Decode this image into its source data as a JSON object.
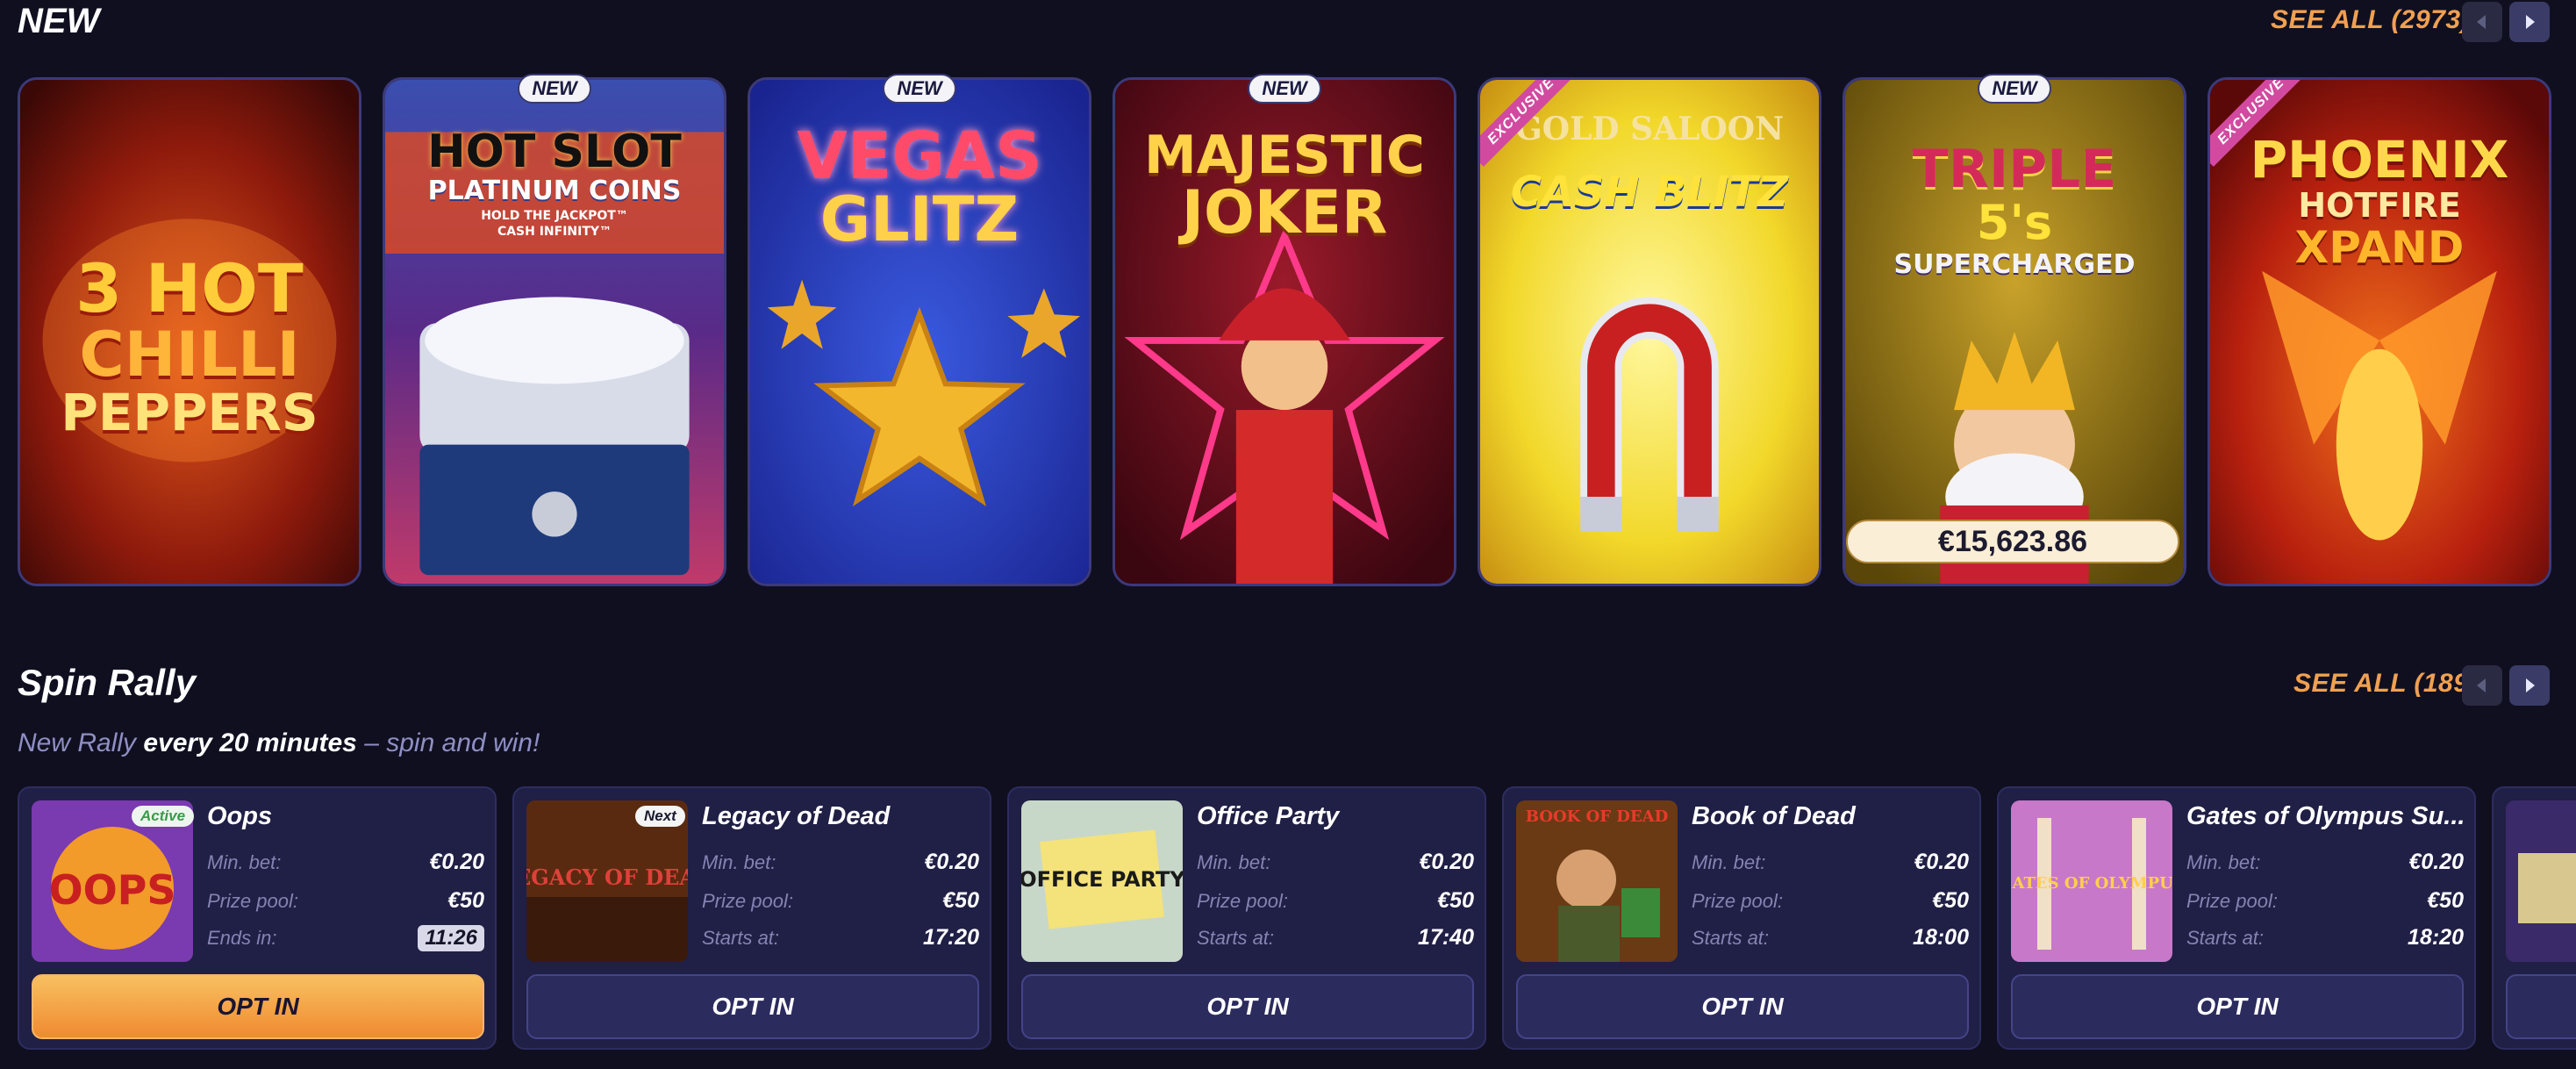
{
  "sections": {
    "new": {
      "title": "NEW",
      "see_all": "SEE ALL (2973)"
    },
    "rally": {
      "title": "Spin Rally",
      "see_all": "SEE ALL (189)",
      "subtitle_pre": "New Rally ",
      "subtitle_bold": "every 20 minutes",
      "subtitle_post": " – spin and win!"
    }
  },
  "games": [
    {
      "title_lines": [
        "3 HOT",
        "CHILLI",
        "PEPPERS"
      ],
      "badge": ""
    },
    {
      "title_lines": [
        "HOT SLOT",
        "PLATINUM COINS",
        "HOLD THE JACKPOT™",
        "CASH INFINITY™"
      ],
      "badge": "NEW"
    },
    {
      "title_lines": [
        "VEGAS",
        "GLITZ"
      ],
      "badge": "NEW"
    },
    {
      "title_lines": [
        "MAJESTIC",
        "JOKER"
      ],
      "badge": "NEW"
    },
    {
      "title_lines": [
        "GOLD SALOON",
        "CASH BLITZ"
      ],
      "badge": "EXCLUSIVE"
    },
    {
      "title_lines": [
        "TRIPLE",
        "5's",
        "SUPERCHARGED"
      ],
      "badge": "NEW",
      "jackpot": "€15,623.86"
    },
    {
      "title_lines": [
        "PHOENIX",
        "HOTFIRE",
        "XPAND"
      ],
      "badge": "EXCLUSIVE"
    }
  ],
  "rallies": [
    {
      "name": "Oops",
      "tag": "Active",
      "thumb_text": "OOPS",
      "min_bet_label": "Min. bet:",
      "min_bet": "€0.20",
      "prize_label": "Prize pool:",
      "prize": "€50",
      "time_label": "Ends in:",
      "time": "11:26",
      "button": "OPT IN"
    },
    {
      "name": "Legacy of Dead",
      "tag": "Next",
      "thumb_text": "LEGACY OF DEAD",
      "min_bet_label": "Min. bet:",
      "min_bet": "€0.20",
      "prize_label": "Prize pool:",
      "prize": "€50",
      "time_label": "Starts at:",
      "time": "17:20",
      "button": "OPT IN"
    },
    {
      "name": "Office Party",
      "tag": "",
      "thumb_text": "OFFICE PARTY",
      "min_bet_label": "Min. bet:",
      "min_bet": "€0.20",
      "prize_label": "Prize pool:",
      "prize": "€50",
      "time_label": "Starts at:",
      "time": "17:40",
      "button": "OPT IN"
    },
    {
      "name": "Book of Dead",
      "tag": "",
      "thumb_text": "BOOK OF DEAD",
      "min_bet_label": "Min. bet:",
      "min_bet": "€0.20",
      "prize_label": "Prize pool:",
      "prize": "€50",
      "time_label": "Starts at:",
      "time": "18:00",
      "button": "OPT IN"
    },
    {
      "name": "Gates of Olympus Su...",
      "tag": "",
      "thumb_text": "GATES OF OLYMPUS",
      "min_bet_label": "Min. bet:",
      "min_bet": "€0.20",
      "prize_label": "Prize pool:",
      "prize": "€50",
      "time_label": "Starts at:",
      "time": "18:20",
      "button": "OPT IN"
    }
  ],
  "colors": {
    "background": "#100f20",
    "accent": "#f0a050",
    "card": "#201f45"
  },
  "icons": {
    "prev": "chevron-left-icon",
    "next": "chevron-right-icon"
  }
}
